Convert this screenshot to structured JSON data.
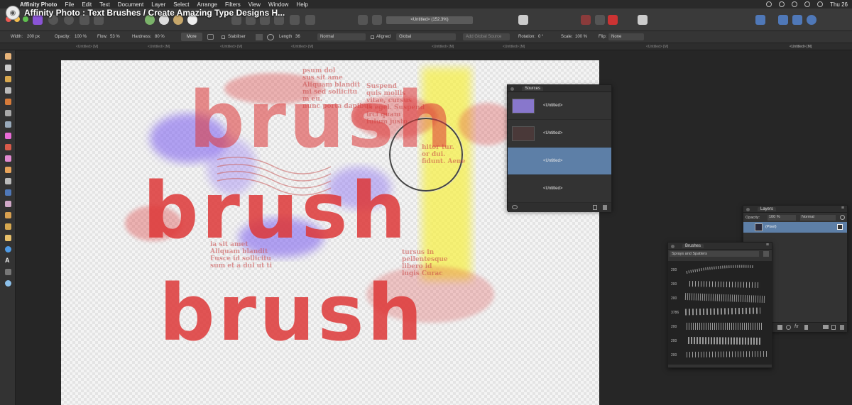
{
  "video_title": "Affinity Photo : Text Brushes / Create Amazing Type Designs H...",
  "menubar": {
    "app": "Affinity Photo",
    "items": [
      "File",
      "Edit",
      "Text",
      "Document",
      "Layer",
      "Select",
      "Arrange",
      "Filters",
      "View",
      "Window",
      "Help"
    ],
    "clock": "Thu 26"
  },
  "toolbar": {
    "document_field": "<Untitled> (152.3%)"
  },
  "context": {
    "width_label": "Width:",
    "width_value": "200 px",
    "opacity_label": "Opacity:",
    "opacity_value": "100 %",
    "flow_label": "Flow:",
    "flow_value": "53 %",
    "hardness_label": "Hardness:",
    "hardness_value": "80 %",
    "more_label": "More",
    "stabiliser_label": "Stabiliser",
    "length_label": "Length",
    "length_value": "36",
    "blend_mode": "Normal",
    "aligned_label": "Aligned",
    "sampling": "Global",
    "add_global_source": "Add Global Source",
    "rotation_label": "Rotation:",
    "rotation_value": "0 °",
    "scale_label": "Scale:",
    "scale_value": "100 %",
    "flip_label": "Flip:",
    "flip_value": "None"
  },
  "tabs": [
    "<Untitled> [M]",
    "<Untitled> [M]",
    "<Untitled> [M]",
    "<Untitled> [M]",
    "<Untitled> [M]",
    "<Untitled> [M]",
    "<Untitled> [M]",
    "<Untitled> [M]"
  ],
  "canvas": {
    "words": [
      "brush",
      "brush",
      "brush"
    ],
    "news_lines": [
      "psum dol\nsus sit ame\nAliquam blandit\nmi sed sollicitu\nm eu.\nnunc porta dapibus",
      "Suspend\nquis mollis\nvitae, cursus\nis egel. Suspend\nirci quam\nfulum justo",
      "hitor tur.\nor dui.\nfidunt. Aene",
      "ia sit amet\nAliquam blandit\nFusce id sollicitu\nsum et a dul ut ti",
      "tursus in\npellentesque\nlibero id\nlugis Curac"
    ]
  },
  "sources_panel": {
    "title": "Sources",
    "rows": [
      {
        "label": "<Untitled>",
        "selected": false
      },
      {
        "label": "<Untitled>",
        "selected": false
      },
      {
        "label": "<Untitled>",
        "selected": true
      },
      {
        "label": "<Untitled>",
        "selected": false
      }
    ]
  },
  "layers_panel": {
    "title": "Layers",
    "opacity_label": "Opacity:",
    "opacity_value": "100 %",
    "blend": "Normal",
    "layer_name": "(Pixel)"
  },
  "brushes_panel": {
    "title": "Brushes",
    "category": "Sprays and Spatters",
    "sizes": [
      "200",
      "200",
      "200",
      "3786",
      "200",
      "200",
      "200"
    ]
  },
  "colors": {
    "selection": "#5d7fa7",
    "brush_red": "#dd3737",
    "brush_purple": "#7a5cf0",
    "brush_yellow": "#f7f040"
  }
}
